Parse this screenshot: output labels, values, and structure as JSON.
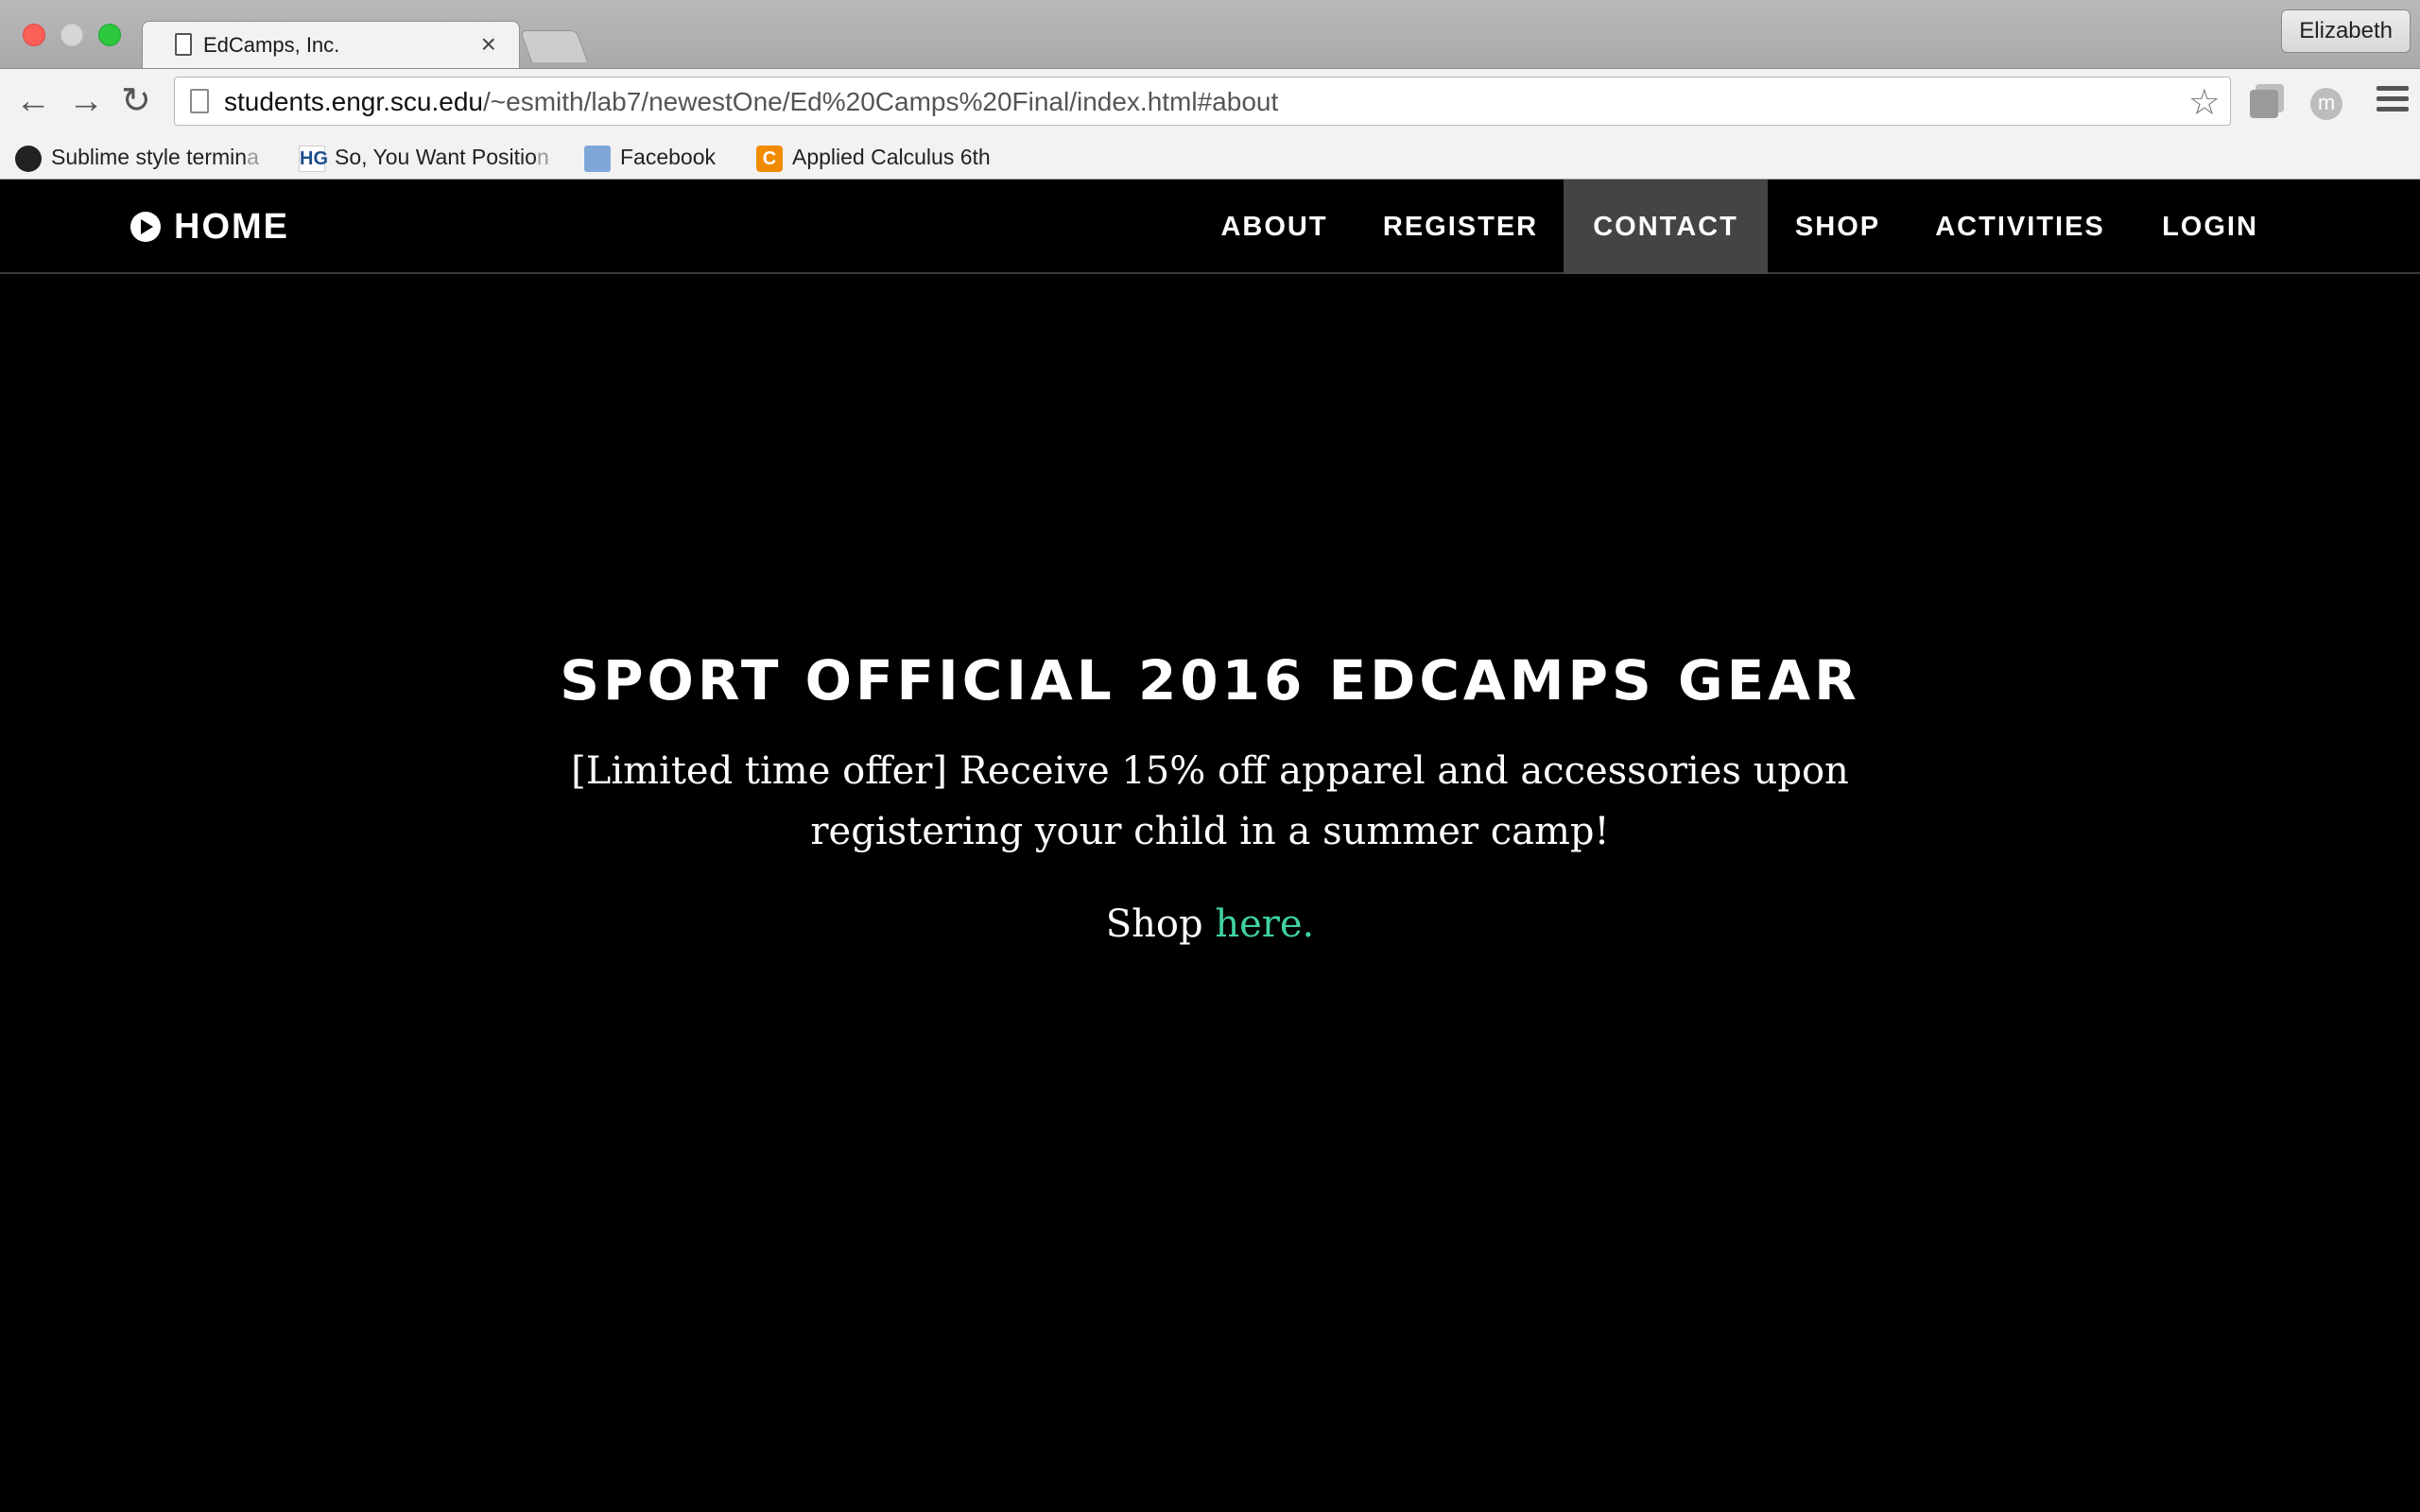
{
  "browser": {
    "tab_title": "EdCamps, Inc.",
    "profile_name": "Elizabeth",
    "url_host": "students.engr.scu.edu",
    "url_path": "/~esmith/lab7/newestOne/Ed%20Camps%20Final/index.html#about",
    "bookmarks": [
      {
        "label": "Sublime style termin",
        "faded": "a",
        "icon": "github-icon"
      },
      {
        "label": "So, You Want Positio",
        "faded": "n",
        "icon": "hg-icon"
      },
      {
        "label": "Facebook",
        "faded": "",
        "icon": "folder-icon"
      },
      {
        "label": "Applied Calculus 6th",
        "faded": "",
        "icon": "c-icon"
      }
    ]
  },
  "site": {
    "brand": "HOME",
    "nav": [
      {
        "label": "ABOUT",
        "active": false
      },
      {
        "label": "REGISTER",
        "active": false
      },
      {
        "label": "CONTACT",
        "active": true
      },
      {
        "label": "SHOP",
        "active": false
      },
      {
        "label": "ACTIVITIES",
        "active": false
      },
      {
        "label": "LOGIN",
        "active": false
      }
    ]
  },
  "hero": {
    "heading": "SPORT OFFICIAL 2016 EDCAMPS GEAR",
    "offer": "[Limited time offer] Receive 15% off apparel and accessories upon registering your child in a summer camp!",
    "shop_prefix": "Shop",
    "shop_link": "here."
  },
  "colors": {
    "link": "#3fd3a0",
    "active_nav_bg": "#444444"
  }
}
